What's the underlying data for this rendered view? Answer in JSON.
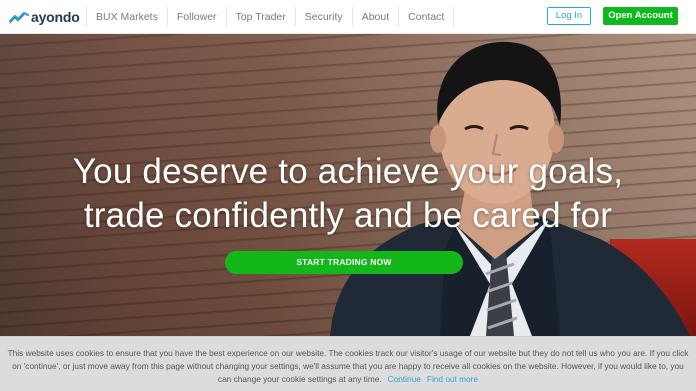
{
  "header": {
    "logo_text": "ayondo",
    "nav": [
      {
        "label": "BUX Markets"
      },
      {
        "label": "Follower"
      },
      {
        "label": "Top Trader"
      },
      {
        "label": "Security"
      },
      {
        "label": "About"
      },
      {
        "label": "Contact"
      }
    ],
    "login_label": "Log In",
    "open_account_label": "Open Account"
  },
  "hero": {
    "headline_line1": "You deserve to achieve your goals,",
    "headline_line2": "trade confidently and be cared for",
    "cta_label": "START TRADING NOW"
  },
  "cookie_bar": {
    "text": "This website uses cookies to ensure that you have the best experience on our website. The cookies track our visitor's usage of our website but they do not tell us who you are. If you click on 'continue', or just move away from this page without changing your settings, we'll assume that you are happy to receive all cookies on the website. However, if you would like to, you can change your cookie settings at any time.",
    "continue_label": "Continue",
    "find_out_more_label": "Find out more"
  },
  "colors": {
    "brand_green": "#11b81d",
    "link_blue": "#29a8e0",
    "logo_dark": "#2b3a4a"
  },
  "icons": {
    "logo": "ayondo-chart-logo-icon"
  }
}
